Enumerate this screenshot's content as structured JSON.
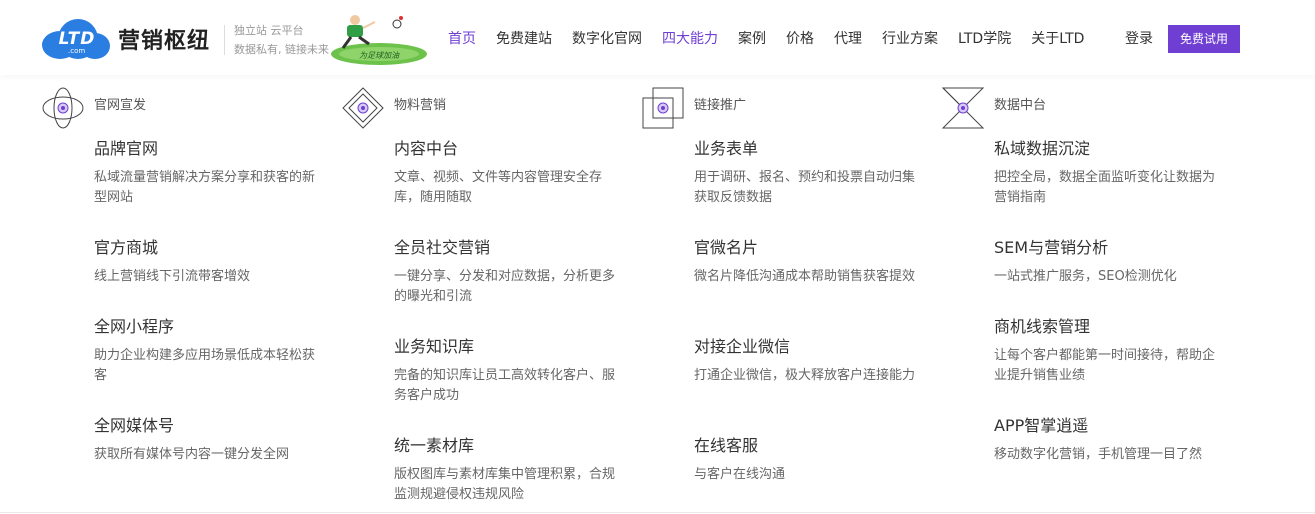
{
  "header": {
    "logo_text": "LTD",
    "logo_sub": ".com",
    "brand": "营销枢纽",
    "slogan_line1": "独立站 云平台",
    "slogan_line2": "数据私有, 链接未来",
    "banner_text": "为足球加油",
    "nav": [
      {
        "label": "首页",
        "active": true
      },
      {
        "label": "免费建站",
        "active": false
      },
      {
        "label": "数字化官网",
        "active": false
      },
      {
        "label": "四大能力",
        "active": true
      },
      {
        "label": "案例",
        "active": false
      },
      {
        "label": "价格",
        "active": false
      },
      {
        "label": "代理",
        "active": false
      },
      {
        "label": "行业方案",
        "active": false
      },
      {
        "label": "LTD学院",
        "active": false
      },
      {
        "label": "关于LTD",
        "active": false
      }
    ],
    "login": "登录",
    "trial": "免费试用",
    "accent": "#6f3fd3",
    "logo_color": "#2a7de1"
  },
  "columns": [
    {
      "label": "官网宣发",
      "icon": "orbit-icon",
      "items": [
        {
          "title": "品牌官网",
          "desc": "私域流量营销解决方案分享和获客的新型网站"
        },
        {
          "title": "官方商城",
          "desc": "线上营销线下引流带客增效"
        },
        {
          "title": "全网小程序",
          "desc": "助力企业构建多应用场景低成本轻松获客"
        },
        {
          "title": "全网媒体号",
          "desc": "获取所有媒体号内容一键分发全网"
        }
      ]
    },
    {
      "label": "物料营销",
      "icon": "diamond-layers-icon",
      "items": [
        {
          "title": "内容中台",
          "desc": "文章、视频、文件等内容管理安全存库，随用随取"
        },
        {
          "title": "全员社交营销",
          "desc": "一键分享、分发和对应数据，分析更多的曝光和引流"
        },
        {
          "title": "业务知识库",
          "desc": "完备的知识库让员工高效转化客户、服务客户成功"
        },
        {
          "title": "统一素材库",
          "desc": "版权图库与素材库集中管理积累，合规监测规避侵权违规风险"
        }
      ]
    },
    {
      "label": "链接推广",
      "icon": "linked-squares-icon",
      "items": [
        {
          "title": "业务表单",
          "desc": "用于调研、报名、预约和投票自动归集获取反馈数据"
        },
        {
          "title": "官微名片",
          "desc": "微名片降低沟通成本帮助销售获客提效"
        },
        {
          "title": "对接企业微信",
          "desc": "打通企业微信，极大释放客户连接能力"
        },
        {
          "title": "在线客服",
          "desc": "与客户在线沟通"
        }
      ]
    },
    {
      "label": "数据中台",
      "icon": "hourglass-icon",
      "items": [
        {
          "title": "私域数据沉淀",
          "desc": "把控全局，数据全面监听变化让数据为营销指南"
        },
        {
          "title": "SEM与营销分析",
          "desc": "一站式推广服务，SEO检测优化"
        },
        {
          "title": "商机线索管理",
          "desc": "让每个客户都能第一时间接待，帮助企业提升销售业绩"
        },
        {
          "title": "APP智掌逍遥",
          "desc": "移动数字化营销，手机管理一目了然"
        }
      ]
    }
  ]
}
